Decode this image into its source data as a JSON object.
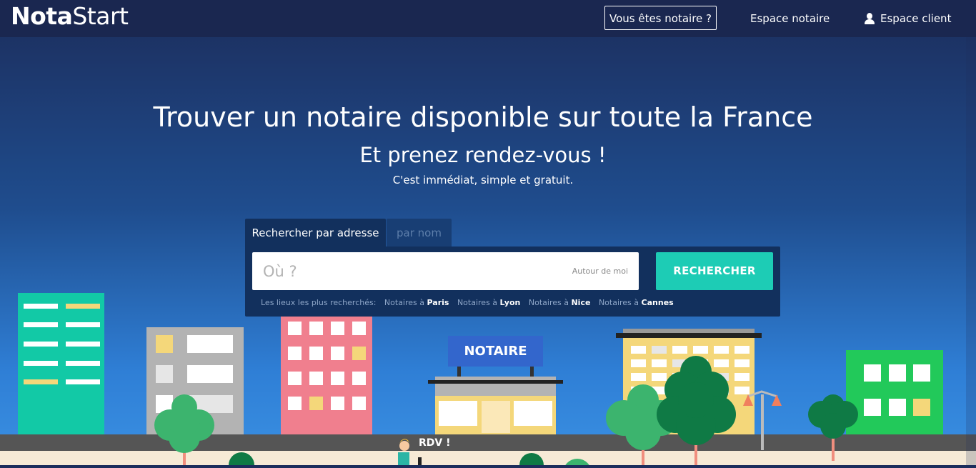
{
  "header": {
    "logo_bold": "Nota",
    "logo_light": "Start",
    "notary_button": "Vous êtes notaire ?",
    "notary_space": "Espace notaire",
    "client_space": "Espace client"
  },
  "hero": {
    "title": "Trouver un notaire disponible sur toute la France",
    "subtitle": "Et prenez rendez-vous !",
    "tagline": "C'est immédiat, simple et gratuit."
  },
  "search": {
    "tab_address": "Rechercher par adresse",
    "tab_name": "par nom",
    "placeholder": "Où ?",
    "value": "",
    "near_me": "Autour de moi",
    "button": "RECHERCHER",
    "popular_label": "Les lieux les plus recherchés:",
    "popular_prefix": "Notaires à",
    "cities": [
      "Paris",
      "Lyon",
      "Nice",
      "Cannes"
    ]
  },
  "illustration": {
    "sign": "NOTAIRE",
    "speech": "RDV !"
  },
  "colors": {
    "topbar": "#1a2750",
    "panel": "#12305d",
    "accent": "#1dccb5",
    "sign": "#3366cc"
  }
}
